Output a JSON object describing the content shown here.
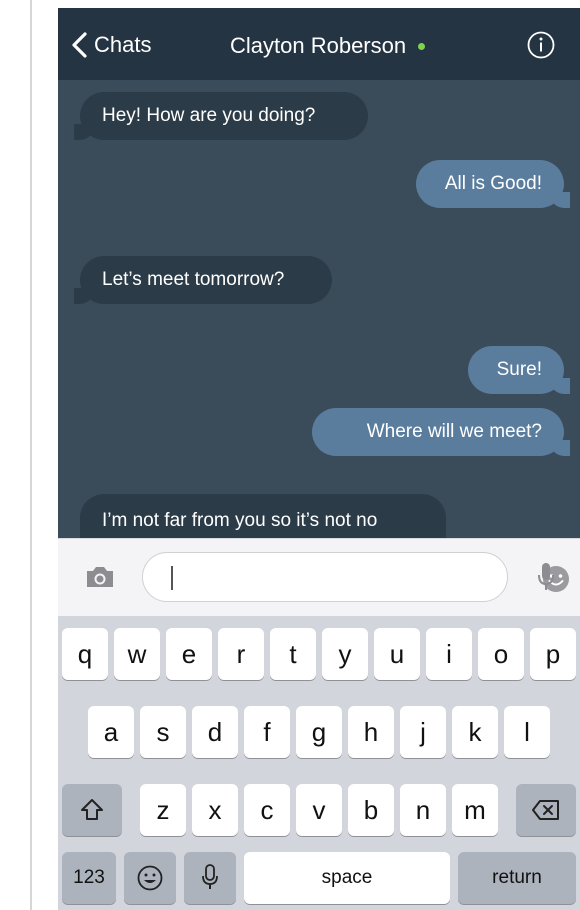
{
  "header": {
    "back_label": "Chats",
    "contact_name": "Clayton Roberson",
    "status_color": "#7fd34a"
  },
  "icons": {
    "back": "chevron-left-icon",
    "info": "info-icon",
    "camera": "camera-icon",
    "emoji": "emoji-icon",
    "microphone": "microphone-icon",
    "shift": "shift-icon",
    "delete": "backspace-icon"
  },
  "colors": {
    "header_bg": "#243442",
    "chat_bg": "#3a4b5a",
    "incoming_bubble": "#2c3b48",
    "outgoing_bubble": "#5a7d9d",
    "keyboard_bg": "#d2d5db"
  },
  "messages": [
    {
      "direction": "in",
      "text": "Hey! How are you doing?"
    },
    {
      "direction": "out",
      "text": "All is Good!"
    },
    {
      "direction": "in",
      "text": "Let’s meet tomorrow?"
    },
    {
      "direction": "out",
      "text": "Sure!"
    },
    {
      "direction": "out",
      "text": "Where will we meet?"
    },
    {
      "direction": "in",
      "text": "I’m not far from you so it’s not no"
    }
  ],
  "composer": {
    "value": "",
    "placeholder": ""
  },
  "keyboard": {
    "row1": [
      "q",
      "w",
      "e",
      "r",
      "t",
      "y",
      "u",
      "i",
      "o",
      "p"
    ],
    "row2": [
      "a",
      "s",
      "d",
      "f",
      "g",
      "h",
      "j",
      "k",
      "l"
    ],
    "row3": [
      "z",
      "x",
      "c",
      "v",
      "b",
      "n",
      "m"
    ],
    "numbers_label": "123",
    "space_label": "space",
    "return_label": "return"
  }
}
